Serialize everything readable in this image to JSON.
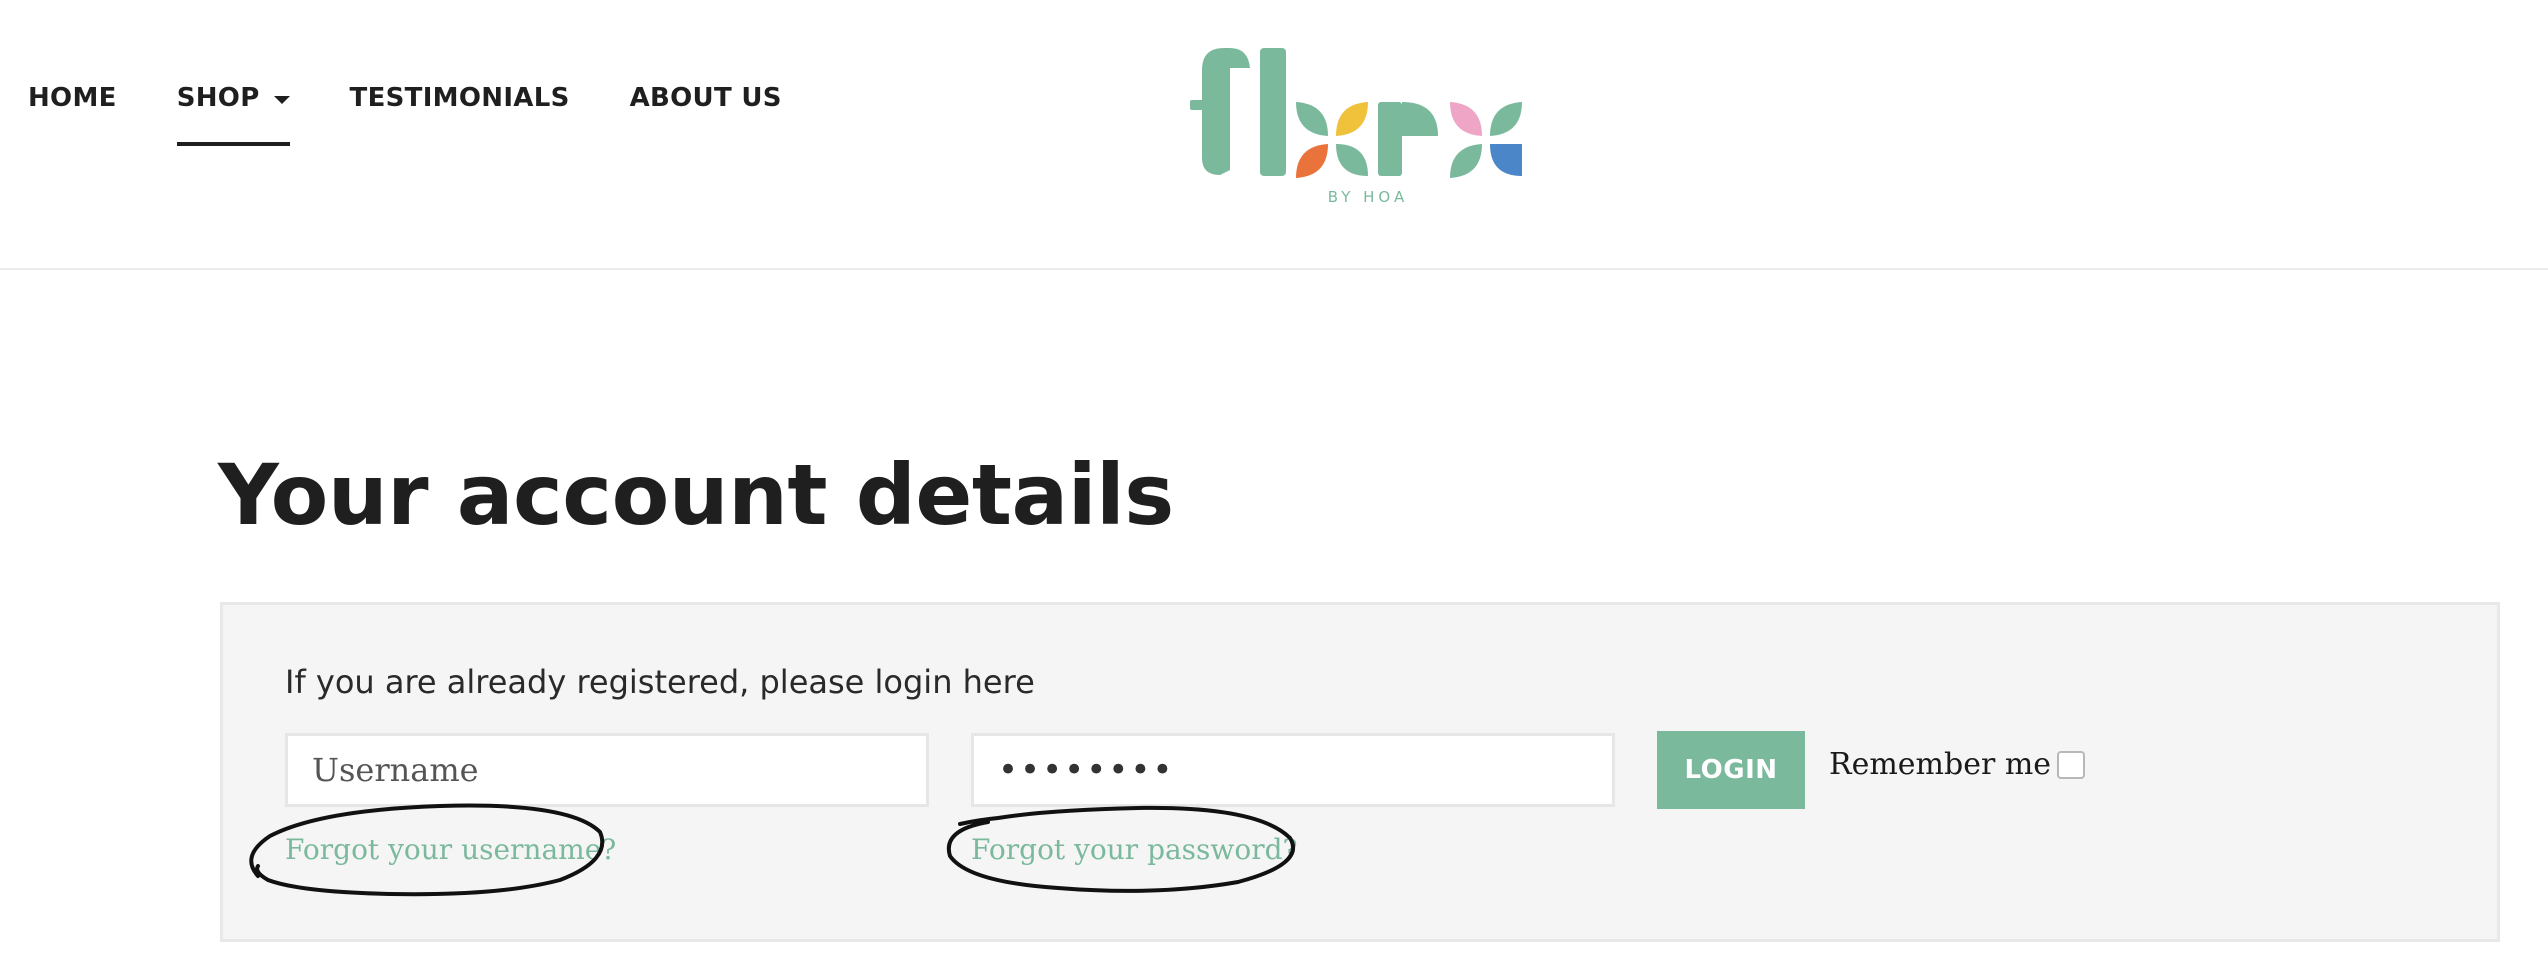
{
  "nav": {
    "items": [
      {
        "label": "HOME"
      },
      {
        "label": "SHOP",
        "has_dropdown": true,
        "active": true
      },
      {
        "label": "TESTIMONIALS"
      },
      {
        "label": "ABOUT US"
      }
    ]
  },
  "logo": {
    "wordmark": "flora",
    "tagline": "BY HOA",
    "colors": {
      "teal": "#7bb99d",
      "yellow": "#f0c23b",
      "orange": "#e9733a",
      "pink": "#eea5c6",
      "blue": "#4a86c8"
    }
  },
  "main": {
    "title": "Your account details",
    "login": {
      "intro": "If you are already registered, please login here",
      "username_placeholder": "Username",
      "password_value": "••••••••",
      "login_button": "LOGIN",
      "remember_label": "Remember me",
      "remember_checked": false,
      "forgot_username": "Forgot your username?",
      "forgot_password": "Forgot your password?"
    }
  },
  "colors": {
    "accent": "#7bb99d",
    "text": "#1f1f1f",
    "panel_bg": "#f5f5f5",
    "annotation": "#111111"
  }
}
